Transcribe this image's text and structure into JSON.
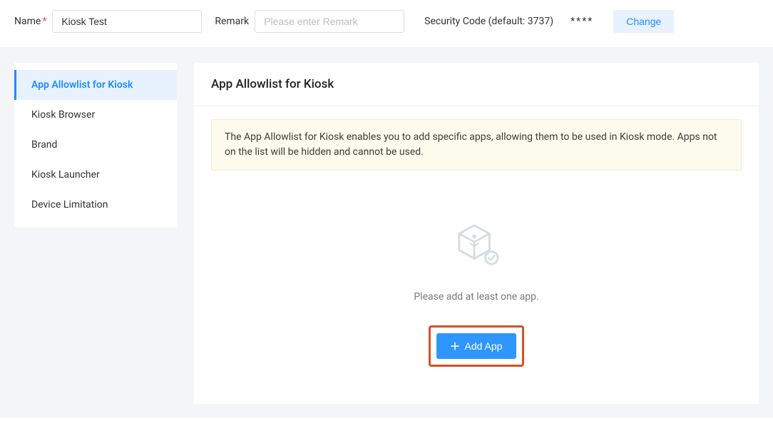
{
  "header": {
    "name_label": "Name",
    "name_value": "Kiosk Test",
    "remark_label": "Remark",
    "remark_placeholder": "Please enter Remark",
    "security_label": "Security Code (default: 3737)",
    "security_mask": "****",
    "change_label": "Change"
  },
  "sidebar": {
    "items": [
      {
        "label": "App Allowlist for Kiosk",
        "active": true
      },
      {
        "label": "Kiosk Browser",
        "active": false
      },
      {
        "label": "Brand",
        "active": false
      },
      {
        "label": "Kiosk Launcher",
        "active": false
      },
      {
        "label": "Device Limitation",
        "active": false
      }
    ]
  },
  "main": {
    "title": "App Allowlist for Kiosk",
    "info": "The App Allowlist for Kiosk enables you to add specific apps, allowing them to be used in Kiosk mode. Apps not on the list will be hidden and cannot be used.",
    "empty_text": "Please add at least one app.",
    "add_label": "Add App"
  }
}
